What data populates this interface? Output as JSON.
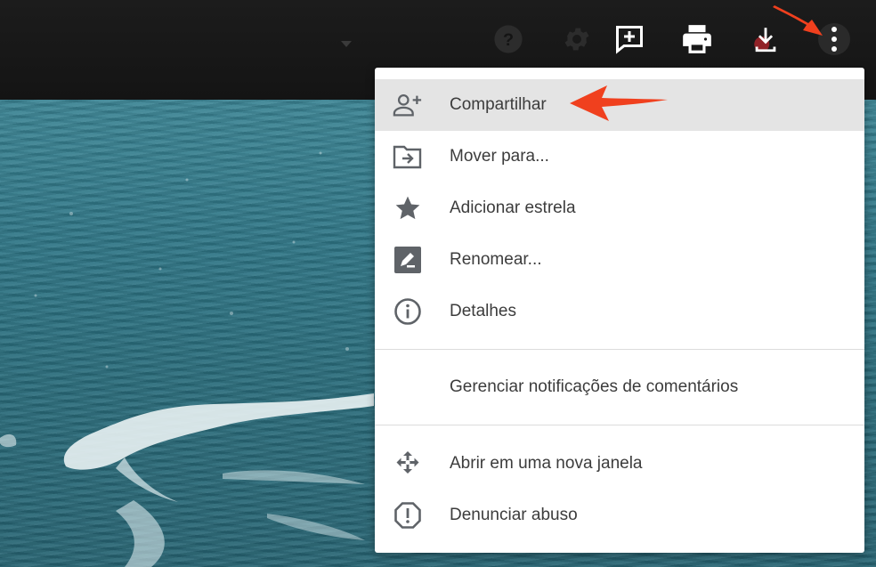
{
  "toolbar": {
    "icons": [
      "help-icon",
      "settings-icon",
      "add-comment-icon",
      "print-icon",
      "download-icon",
      "more-vert-icon"
    ]
  },
  "menu": {
    "items": [
      {
        "label": "Compartilhar",
        "icon": "person-add-icon"
      },
      {
        "label": "Mover para...",
        "icon": "move-to-folder-icon"
      },
      {
        "label": "Adicionar estrela",
        "icon": "star-icon"
      },
      {
        "label": "Renomear...",
        "icon": "rename-icon"
      },
      {
        "label": "Detalhes",
        "icon": "info-icon"
      },
      {
        "label": "Gerenciar notificações de comentários",
        "icon": ""
      },
      {
        "label": "Abrir em uma nova janela",
        "icon": "open-in-new-window-icon"
      },
      {
        "label": "Denunciar abuso",
        "icon": "report-icon"
      }
    ],
    "highlighted_index": 0
  },
  "colors": {
    "topbar": "#1a1a1a",
    "menu_background": "#ffffff",
    "highlight": "#e4e4e4",
    "annotation_arrow": "#f0401e",
    "icon_gray": "#5f6368"
  }
}
